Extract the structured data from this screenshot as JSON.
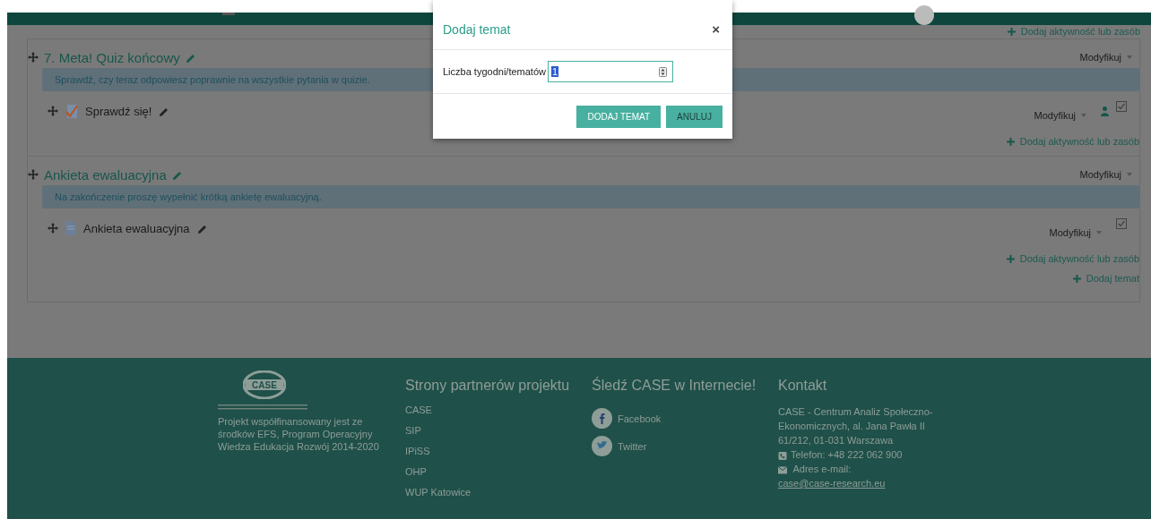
{
  "top_add_link": "Dodaj aktywność lub zasób",
  "sections": [
    {
      "title": "7. Meta! Quiz końcowy",
      "modify": "Modyfikuj",
      "summary": "Sprawdź, czy teraz odpowiesz poprawnie na wszystkie pytania w quizie.",
      "activities": [
        {
          "kind": "quiz",
          "name": "Sprawdź się!",
          "modify": "Modyfikuj",
          "restricted": true,
          "checked": true
        }
      ],
      "add_link": "Dodaj aktywność lub zasób"
    },
    {
      "title": "Ankieta ewaluacyjna",
      "modify": "Modyfikuj",
      "summary": "Na zakończenie proszę wypełnić krótką ankietę ewaluacyjną.",
      "activities": [
        {
          "kind": "feedback",
          "name": "Ankieta ewaluacyjna",
          "modify": "Modyfikuj",
          "restricted": false,
          "checked": true
        }
      ],
      "add_link": "Dodaj aktywność lub zasób"
    }
  ],
  "add_topic": "Dodaj temat",
  "footer": {
    "logo": "CASE",
    "project_text": "Projekt współfinansowany jest ze środków EFS, Program Operacyjny Wiedza Edukacja Rozwój 2014-2020",
    "partners": {
      "heading": "Strony partnerów projektu",
      "links": [
        "CASE",
        "SIP",
        "IPiSS",
        "OHP",
        "WUP Katowice"
      ]
    },
    "social": {
      "heading": "Śledź CASE w Internecie!",
      "links": [
        {
          "kind": "facebook",
          "label": "Facebook"
        },
        {
          "kind": "twitter",
          "label": "Twitter"
        }
      ]
    },
    "contact": {
      "heading": "Kontakt",
      "address": "CASE - Centrum Analiz Społeczno-Ekonomicznych, al. Jana Pawła II 61/212, 01-031 Warszawa",
      "phone": "Telefon: +48 222 062 900",
      "email_label": "Adres e-mail:",
      "email": "case@case-research.eu"
    }
  },
  "dialog": {
    "title": "Dodaj temat",
    "close": "×",
    "field_label": "Liczba tygodni/tematów",
    "field_value": "1",
    "buttons": [
      {
        "kind": "primary",
        "label": "DODAJ TEMAT"
      },
      {
        "kind": "secondary",
        "label": "ANULUJ"
      }
    ]
  }
}
